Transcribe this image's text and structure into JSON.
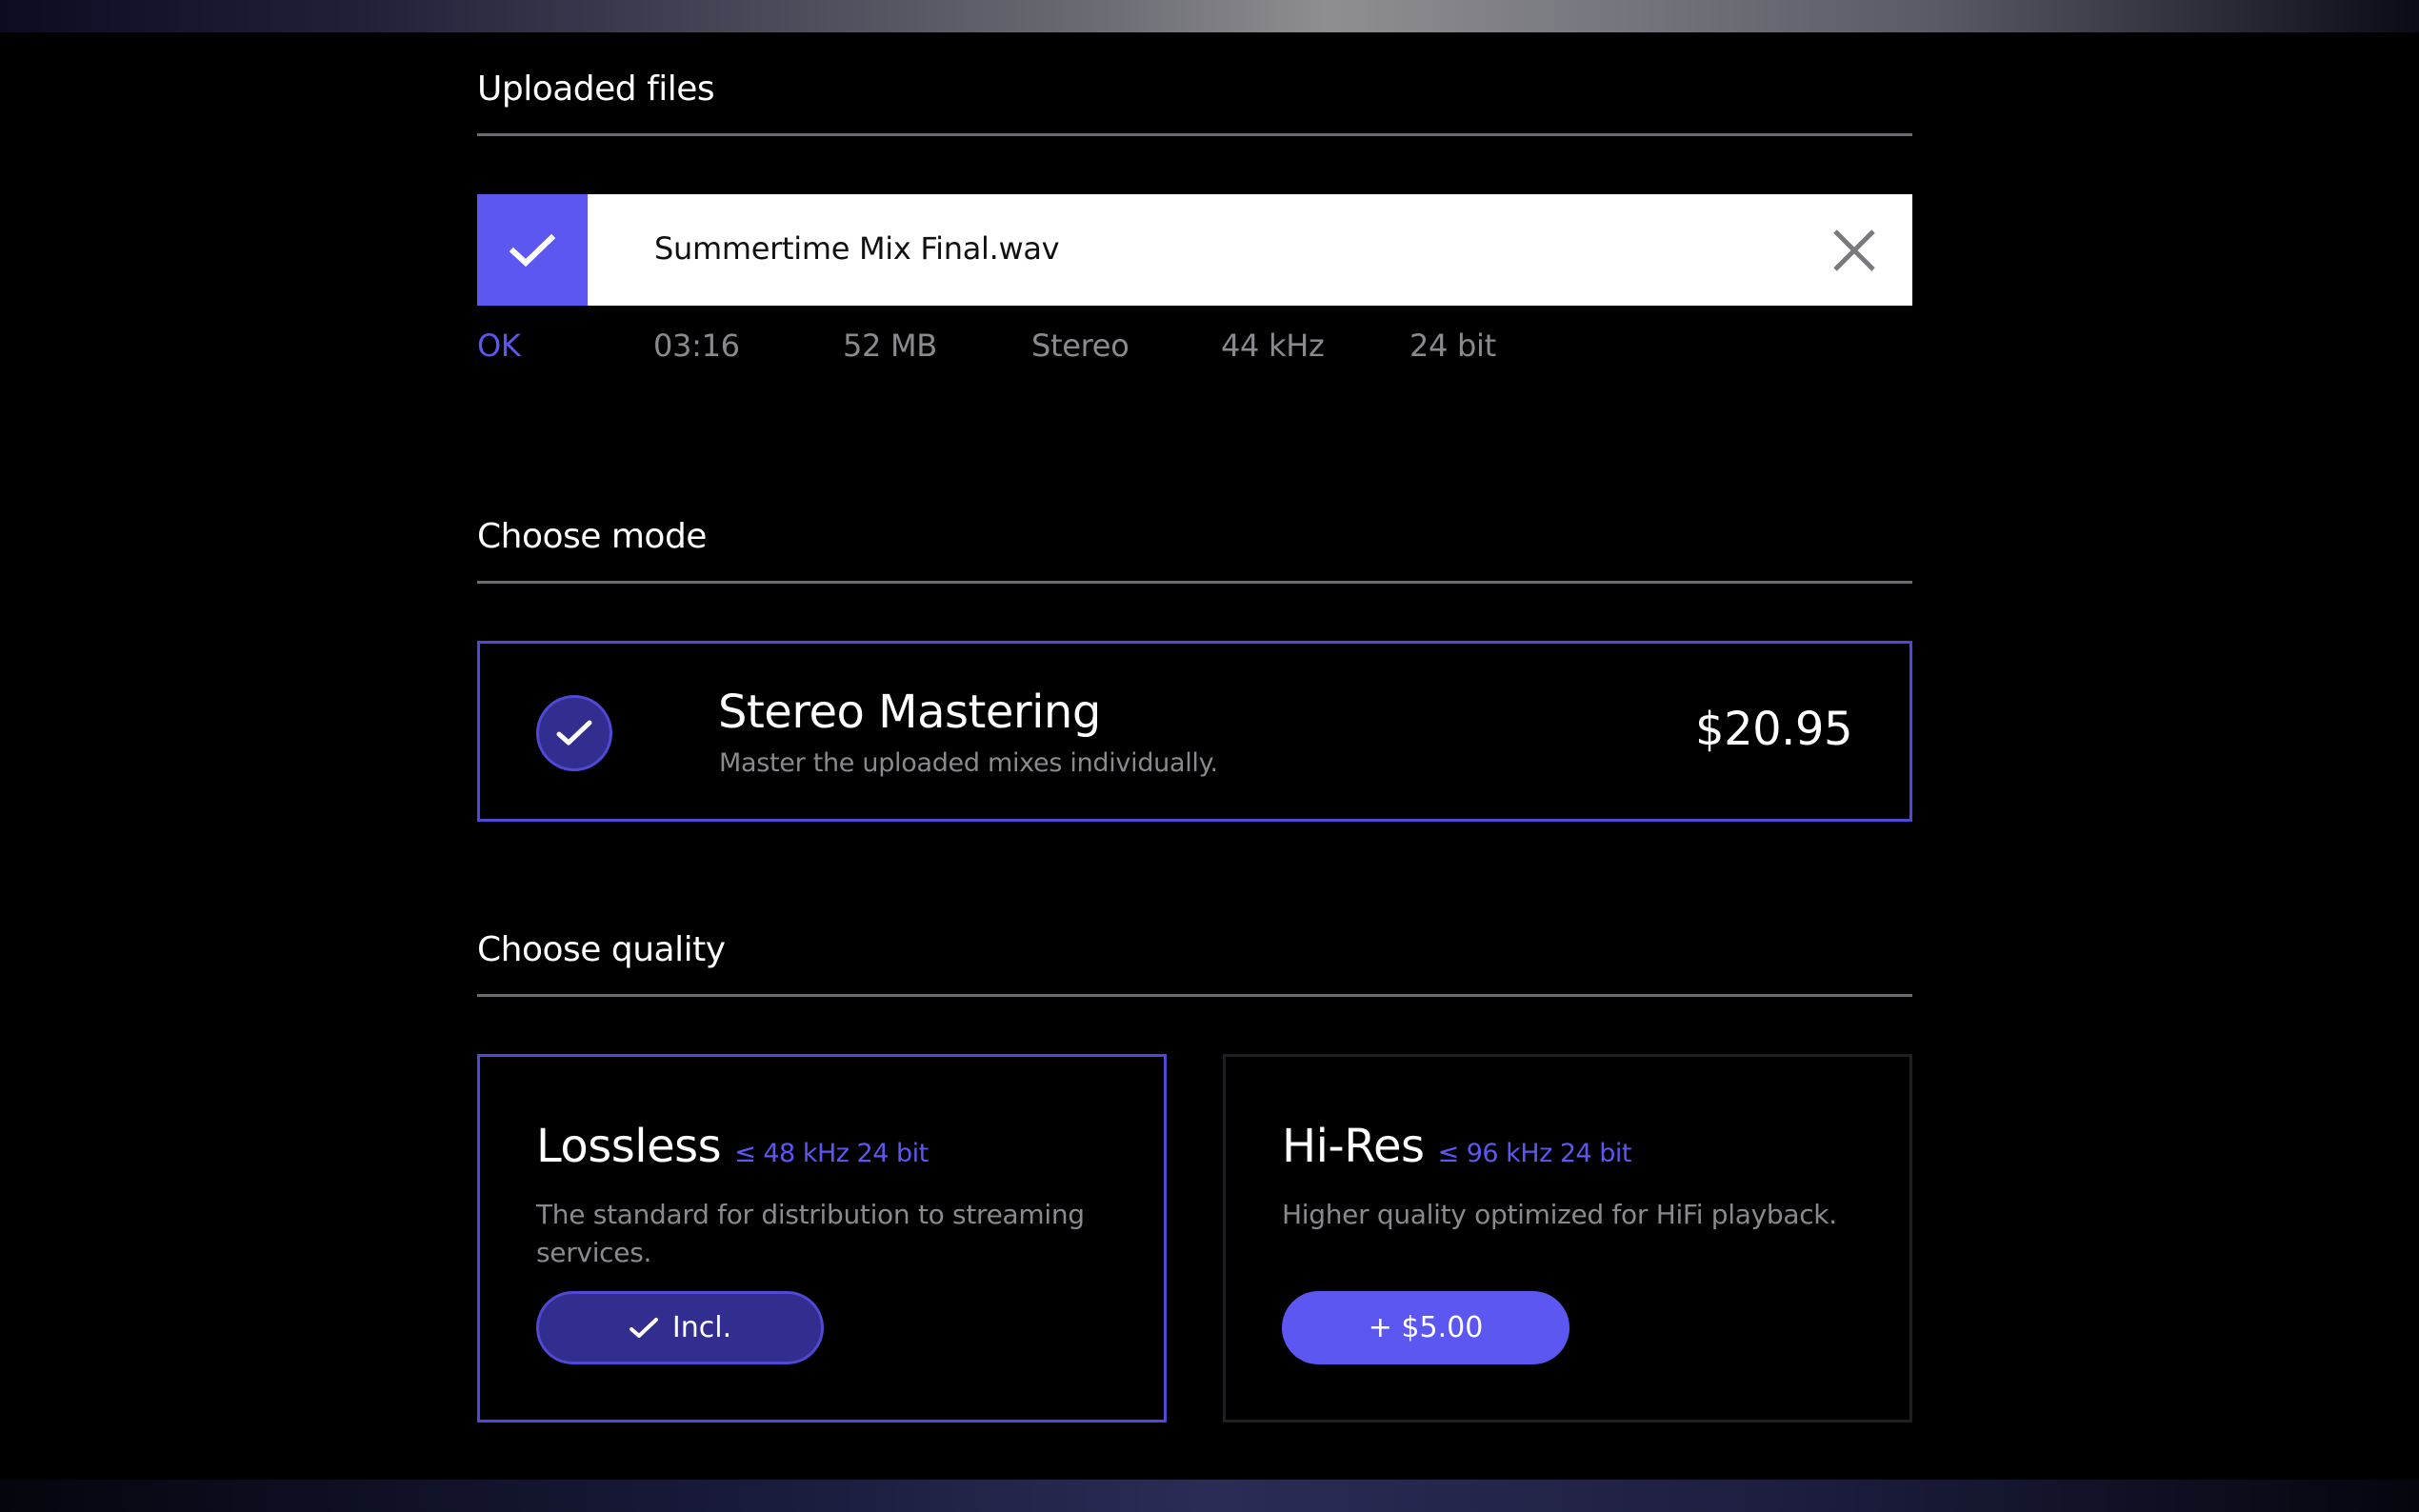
{
  "sections": {
    "uploaded_title": "Uploaded files",
    "mode_title": "Choose mode",
    "quality_title": "Choose quality"
  },
  "file": {
    "name": "Summertime Mix Final.wav",
    "status": "OK",
    "duration": "03:16",
    "size": "52 MB",
    "channels": "Stereo",
    "sample_rate": "44 kHz",
    "bit_depth": "24 bit",
    "icons": {
      "check": "check-icon",
      "remove": "close-icon"
    }
  },
  "mode": {
    "title": "Stereo Mastering",
    "description": "Master the uploaded mixes individually.",
    "price": "$20.95",
    "selected": true
  },
  "quality": [
    {
      "title": "Lossless",
      "spec": "≤ 48 kHz 24 bit",
      "description": "The standard for distribution to streaming services.",
      "button_label": "Incl.",
      "selected": true
    },
    {
      "title": "Hi-Res",
      "spec": "≤ 96 kHz 24 bit",
      "description": "Higher quality optimized for HiFi playback.",
      "button_label": "+ $5.00",
      "selected": false
    }
  ],
  "colors": {
    "accent": "#5d57f1",
    "accent_dark": "#322e8f",
    "border_selected": "#4f49d6",
    "muted_text": "#8a8a8e",
    "background": "#000000"
  }
}
